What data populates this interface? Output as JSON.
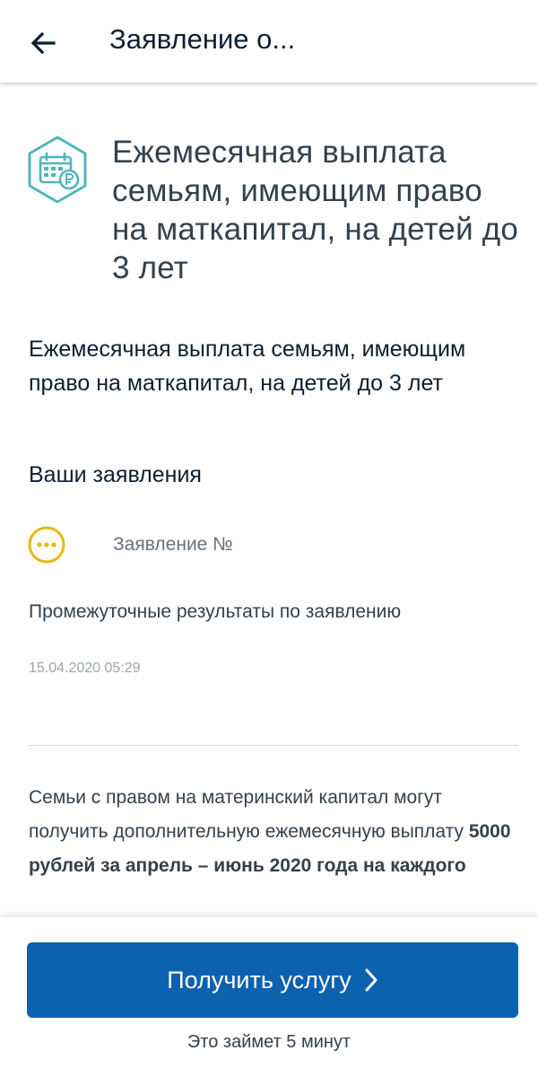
{
  "header": {
    "title": "Заявление о...",
    "back_icon": "arrow-left-icon"
  },
  "service": {
    "icon": "calendar-ruble-icon",
    "title": "Ежемесячная выплата семьям, имеющим право на маткапитал, на детей до 3 лет",
    "subtitle": "Ежемесячная выплата семьям, имеющим право на маткапитал, на детей до 3 лет"
  },
  "applications": {
    "section_title": "Ваши заявления",
    "items": [
      {
        "status_icon": "pending-dots-icon",
        "label": "Заявление №",
        "status_text": "Промежуточные результаты по заявлению",
        "timestamp": "15.04.2020 05:29"
      }
    ]
  },
  "description": {
    "part1": "Семьи с правом на материнский капитал могут получить дополнительную ежемесячную выплату ",
    "bold": "5000 рублей за апрель – июнь 2020 года на каждого"
  },
  "cta": {
    "label": "Получить услугу",
    "duration": "Это займет 5 минут"
  },
  "colors": {
    "primary": "#0d62b0",
    "accent_teal": "#4fb6bd",
    "pending_yellow": "#e8b80e"
  }
}
